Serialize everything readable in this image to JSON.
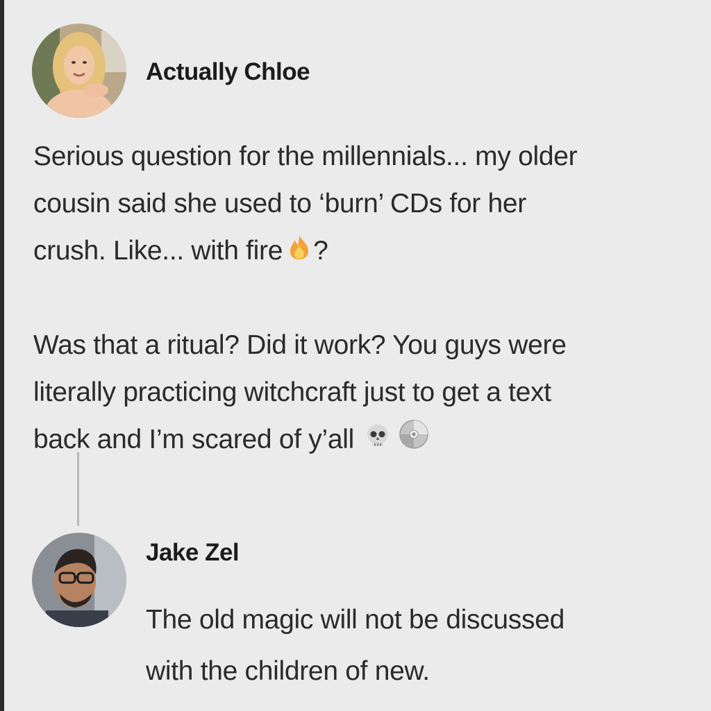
{
  "post": {
    "author": "Actually Chloe",
    "para1": {
      "line1": "Serious question for the millennials... my older",
      "line2": "cousin said she used to ‘burn’ CDs for her",
      "line3_pre": "crush. Like... with fire",
      "line3_post": "?"
    },
    "para2": {
      "line1": "Was that a ritual? Did it work? You guys were",
      "line2": "literally practicing witchcraft just to get a text",
      "line3": "back and I’m scared of y’all"
    },
    "emojis": [
      "fire-emoji",
      "skull-emoji",
      "cd-emoji"
    ]
  },
  "reply": {
    "author": "Jake Zel",
    "line1": "The old magic will not be discussed",
    "line2": "with the children of new."
  }
}
